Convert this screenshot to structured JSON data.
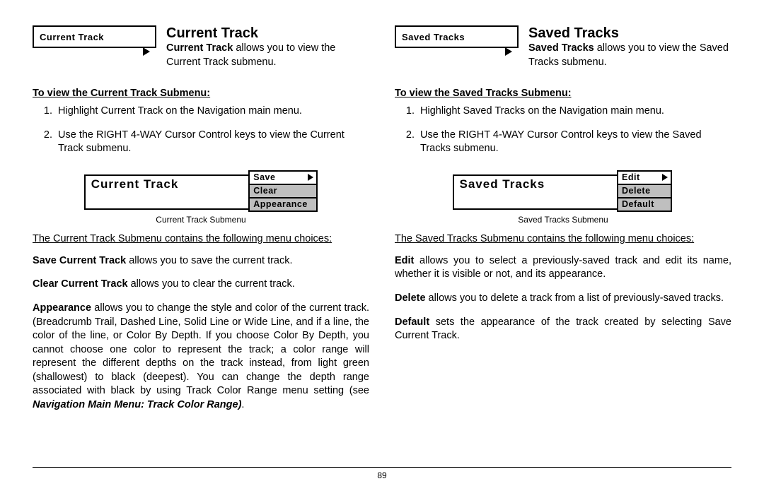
{
  "page_number": "89",
  "left": {
    "menu_button": "Current Track",
    "heading": "Current Track",
    "intro_bold": "Current Track",
    "intro_rest": " allows you to view the Current Track submenu.",
    "subhead": "To view the Current Track Submenu:",
    "steps": [
      "Highlight Current Track on the Navigation main menu.",
      "Use the RIGHT 4-WAY Cursor Control keys to view the Current Track submenu."
    ],
    "submenu_title": "Current Track",
    "submenu_items": [
      "Save",
      "Clear",
      "Appearance"
    ],
    "submenu_caption": "Current Track Submenu",
    "choices_head": "The Current Track Submenu contains the following menu choices:",
    "p1_bold": "Save Current Track",
    "p1_rest": " allows you to save the current track.",
    "p2_bold": "Clear Current Track",
    "p2_rest": " allows you to clear the current track.",
    "p3_bold": "Appearance",
    "p3_rest": " allows you to change the style and color of the current track. (Breadcrumb Trail, Dashed Line, Solid Line or Wide Line, and if a line, the color of the line, or Color By Depth. If you choose Color By Depth, you cannot choose one color to represent the track; a color range will represent the different depths on the track instead, from light green (shallowest) to black (deepest). You can change the depth range associated with black by using Track Color Range menu setting (see ",
    "p3_italic": "Navigation Main Menu: Track Color Range)",
    "p3_end": "."
  },
  "right": {
    "menu_button": "Saved Tracks",
    "heading": "Saved Tracks",
    "intro_bold": "Saved Tracks",
    "intro_rest": " allows you to view the Saved Tracks submenu.",
    "subhead": "To view the Saved Tracks Submenu:",
    "steps": [
      "Highlight Saved Tracks on the Navigation main menu.",
      "Use the RIGHT 4-WAY Cursor Control keys to view the Saved Tracks submenu."
    ],
    "submenu_title": "Saved Tracks",
    "submenu_items": [
      "Edit",
      "Delete",
      "Default"
    ],
    "submenu_caption": "Saved Tracks Submenu",
    "choices_head": "The Saved Tracks Submenu contains the following menu choices:",
    "p1_bold": "Edit",
    "p1_rest": " allows you to select a previously-saved track and edit its name, whether it is visible or not, and its appearance.",
    "p2_bold": "Delete",
    "p2_rest": " allows you to delete a track from a list of previously-saved tracks.",
    "p3_bold": "Default",
    "p3_rest": " sets the appearance of the track created by selecting Save Current Track."
  }
}
